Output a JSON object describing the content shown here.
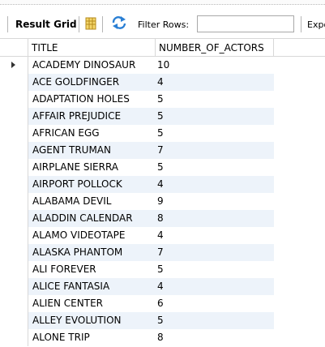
{
  "toolbar": {
    "result_grid_label": "Result Grid",
    "filter_label": "Filter Rows:",
    "filter_value": "",
    "export_label": "Expo"
  },
  "columns": [
    "TITLE",
    "NUMBER_OF_ACTORS"
  ],
  "rows": [
    {
      "title": "ACADEMY DINOSAUR",
      "actors": "10"
    },
    {
      "title": "ACE GOLDFINGER",
      "actors": "4"
    },
    {
      "title": "ADAPTATION HOLES",
      "actors": "5"
    },
    {
      "title": "AFFAIR PREJUDICE",
      "actors": "5"
    },
    {
      "title": "AFRICAN EGG",
      "actors": "5"
    },
    {
      "title": "AGENT TRUMAN",
      "actors": "7"
    },
    {
      "title": "AIRPLANE SIERRA",
      "actors": "5"
    },
    {
      "title": "AIRPORT POLLOCK",
      "actors": "4"
    },
    {
      "title": "ALABAMA DEVIL",
      "actors": "9"
    },
    {
      "title": "ALADDIN CALENDAR",
      "actors": "8"
    },
    {
      "title": "ALAMO VIDEOTAPE",
      "actors": "4"
    },
    {
      "title": "ALASKA PHANTOM",
      "actors": "7"
    },
    {
      "title": "ALI FOREVER",
      "actors": "5"
    },
    {
      "title": "ALICE FANTASIA",
      "actors": "4"
    },
    {
      "title": "ALIEN CENTER",
      "actors": "6"
    },
    {
      "title": "ALLEY EVOLUTION",
      "actors": "5"
    },
    {
      "title": "ALONE TRIP",
      "actors": "8"
    }
  ],
  "colors": {
    "alt_row": "#edf3fa",
    "grid_line": "#d8d8d8"
  }
}
